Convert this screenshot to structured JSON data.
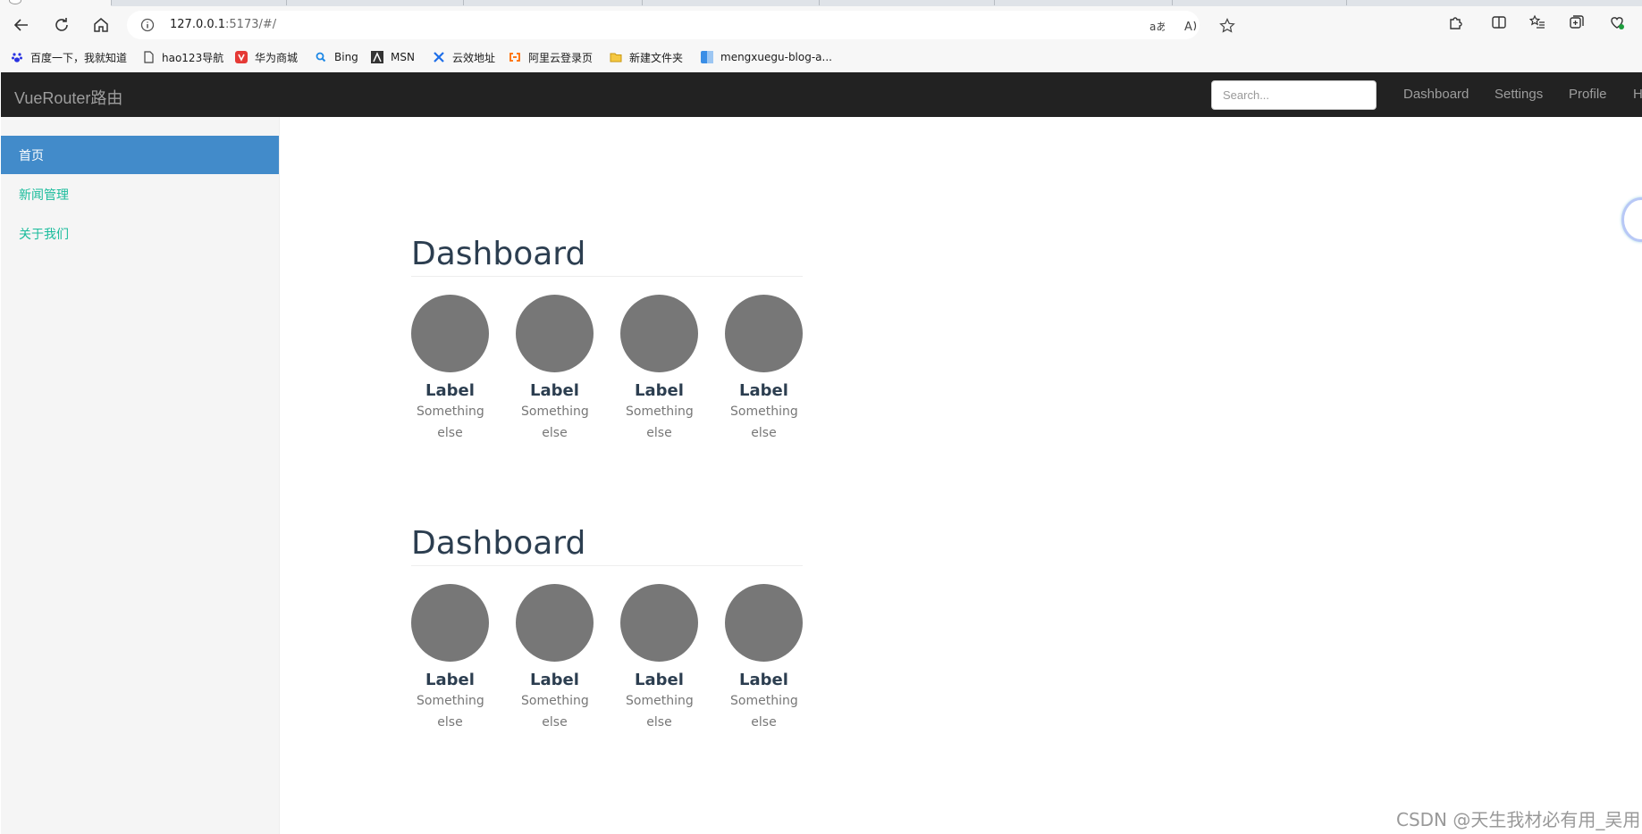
{
  "browser": {
    "url_host": "127.0.0.1",
    "url_rest": ":5173/#/"
  },
  "bookmarks": [
    {
      "label": "百度一下，我就知道",
      "icon": "baidu-paw-icon",
      "color": "#2932e1"
    },
    {
      "label": "hao123导航",
      "icon": "page-icon",
      "color": "#444444"
    },
    {
      "label": "华为商城",
      "icon": "vmall-icon",
      "color": "#e53935"
    },
    {
      "label": "Bing",
      "icon": "bing-search-icon",
      "color": "#1e88e5"
    },
    {
      "label": "MSN",
      "icon": "msn-icon",
      "color": "#333333"
    },
    {
      "label": "云效地址",
      "icon": "yunxiao-icon",
      "color": "#1e6ee8"
    },
    {
      "label": "阿里云登录页",
      "icon": "aliyun-icon",
      "color": "#ff6a00"
    },
    {
      "label": "新建文件夹",
      "icon": "folder-icon",
      "color": "#e8b420"
    },
    {
      "label": "mengxuegu-blog-a...",
      "icon": "blog-icon",
      "color": "#3a8ee6"
    }
  ],
  "app": {
    "brand": "VueRouter路由",
    "search_placeholder": "Search...",
    "nav_links": [
      "Dashboard",
      "Settings",
      "Profile",
      "H"
    ]
  },
  "sidebar": {
    "items": [
      {
        "label": "首页",
        "active": true
      },
      {
        "label": "新闻管理",
        "active": false
      },
      {
        "label": "关于我们",
        "active": false
      }
    ]
  },
  "sections": [
    {
      "title": "Dashboard",
      "placeholders": [
        {
          "label": "Label",
          "text": "Something else"
        },
        {
          "label": "Label",
          "text": "Something else"
        },
        {
          "label": "Label",
          "text": "Something else"
        },
        {
          "label": "Label",
          "text": "Something else"
        }
      ]
    },
    {
      "title": "Dashboard",
      "placeholders": [
        {
          "label": "Label",
          "text": "Something else"
        },
        {
          "label": "Label",
          "text": "Something else"
        },
        {
          "label": "Label",
          "text": "Something else"
        },
        {
          "label": "Label",
          "text": "Something else"
        }
      ]
    }
  ],
  "watermark": "CSDN @天生我材必有用_吴用",
  "colors": {
    "navbar": "#222222",
    "sidebar_active": "#428bca",
    "sidebar_link": "#1abc9c",
    "heading": "#2c3e50",
    "placeholder_circle": "#777777"
  }
}
